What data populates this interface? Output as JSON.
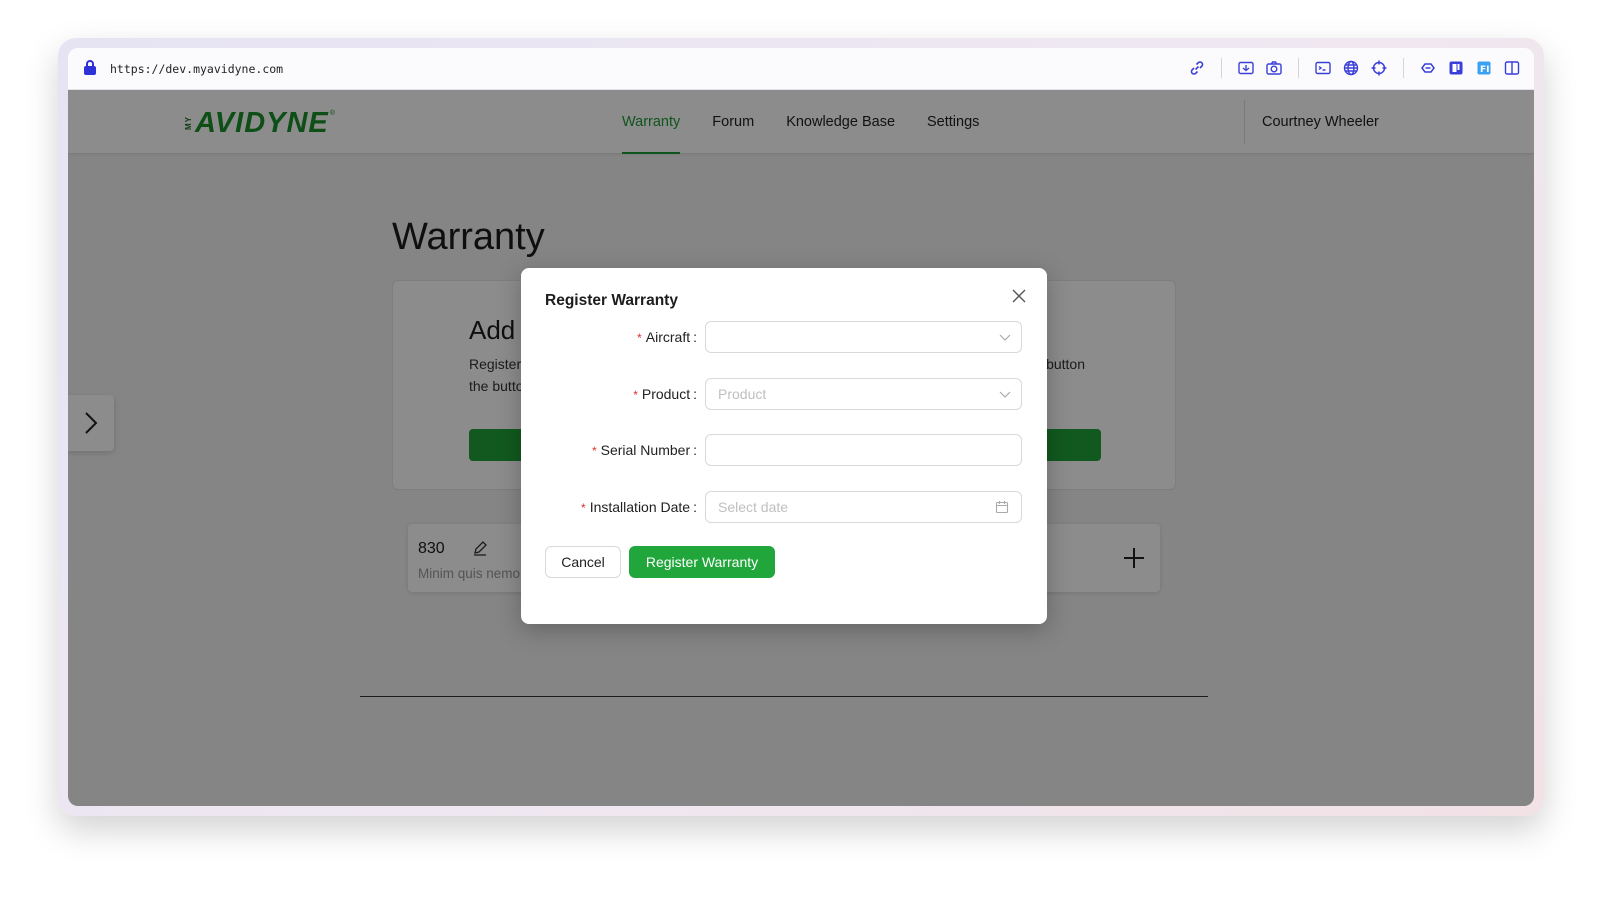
{
  "browser": {
    "url": "https://dev.myavidyne.com",
    "toolbar_icons": [
      "link-icon",
      "screenshot-icon",
      "camera-icon",
      "terminal-icon",
      "globe-icon",
      "crosshair-icon",
      "extension-icon",
      "reader-icon",
      "figma-icon",
      "sidebar-icon"
    ]
  },
  "header": {
    "logo_prefix": "MY",
    "logo_text": "AVIDYNE",
    "logo_reg": "®",
    "nav": [
      {
        "label": "Warranty",
        "active": true
      },
      {
        "label": "Forum",
        "active": false
      },
      {
        "label": "Knowledge Base",
        "active": false
      },
      {
        "label": "Settings",
        "active": false
      }
    ],
    "user_name": "Courtney Wheeler"
  },
  "main": {
    "page_title": "Warranty",
    "card": {
      "title": "Add a",
      "text_line1": "Register",
      "text_line1_tail": "button",
      "text_line2": "the butto"
    },
    "item": {
      "name": "830",
      "description": "Minim quis nemo"
    }
  },
  "modal": {
    "title": "Register Warranty",
    "fields": {
      "aircraft": {
        "label": "Aircraft",
        "value": ""
      },
      "product": {
        "label": "Product",
        "placeholder": "Product"
      },
      "serial": {
        "label": "Serial Number",
        "value": ""
      },
      "install_date": {
        "label": "Installation Date",
        "placeholder": "Select date"
      }
    },
    "cancel_label": "Cancel",
    "submit_label": "Register Warranty"
  },
  "colors": {
    "brand_green": "#21a63c",
    "required_red": "#e0302e"
  }
}
